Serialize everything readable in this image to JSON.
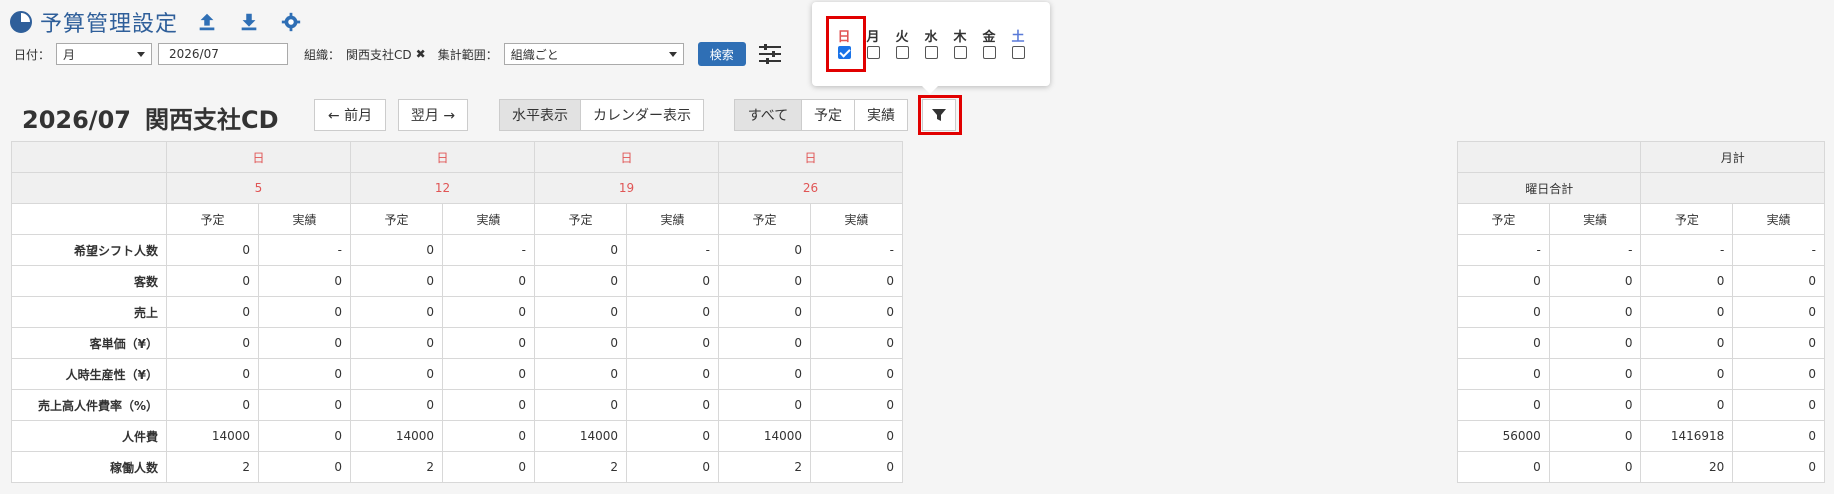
{
  "header": {
    "title": "予算管理設定",
    "icons": [
      "pie-chart-icon",
      "upload-icon",
      "download-icon",
      "gear-icon"
    ]
  },
  "filters": {
    "date_label": "日付：",
    "date_unit": "月",
    "date_value": "2026/07",
    "org_label": "組織：",
    "org_value": "関西支社CD",
    "scope_label": "集計範囲：",
    "scope_value": "組織ごと",
    "search_label": "検索"
  },
  "main": {
    "period": "2026/07",
    "org": "関西支社CD",
    "prev_label": "← 前月",
    "next_label": "翌月 →",
    "view_tabs": [
      "水平表示",
      "カレンダー表示"
    ],
    "kind_tabs": [
      "すべて",
      "予定",
      "実績"
    ]
  },
  "day_filter": {
    "days": [
      {
        "label": "日",
        "checked": true,
        "color": "#e05555"
      },
      {
        "label": "月",
        "checked": false,
        "color": "#333333"
      },
      {
        "label": "火",
        "checked": false,
        "color": "#333333"
      },
      {
        "label": "水",
        "checked": false,
        "color": "#333333"
      },
      {
        "label": "木",
        "checked": false,
        "color": "#333333"
      },
      {
        "label": "金",
        "checked": false,
        "color": "#333333"
      },
      {
        "label": "土",
        "checked": false,
        "color": "#5a7bd8"
      }
    ]
  },
  "table": {
    "weekday": "日",
    "dates": [
      "5",
      "12",
      "19",
      "26"
    ],
    "sub_headers": [
      "予定",
      "実績"
    ],
    "row_labels": [
      "希望シフト人数",
      "客数",
      "売上",
      "客単価（¥）",
      "人時生産性（¥）",
      "売上高人件費率（%）",
      "人件費",
      "稼働人数"
    ],
    "rows": [
      [
        "0",
        "-",
        "0",
        "-",
        "0",
        "-",
        "0",
        "-"
      ],
      [
        "0",
        "0",
        "0",
        "0",
        "0",
        "0",
        "0",
        "0"
      ],
      [
        "0",
        "0",
        "0",
        "0",
        "0",
        "0",
        "0",
        "0"
      ],
      [
        "0",
        "0",
        "0",
        "0",
        "0",
        "0",
        "0",
        "0"
      ],
      [
        "0",
        "0",
        "0",
        "0",
        "0",
        "0",
        "0",
        "0"
      ],
      [
        "0",
        "0",
        "0",
        "0",
        "0",
        "0",
        "0",
        "0"
      ],
      [
        "14000",
        "0",
        "14000",
        "0",
        "14000",
        "0",
        "14000",
        "0"
      ],
      [
        "2",
        "0",
        "2",
        "0",
        "2",
        "0",
        "2",
        "0"
      ]
    ]
  },
  "summary": {
    "weekday_total_label": "曜日合計",
    "monthly_label": "月計",
    "sub_headers": [
      "予定",
      "実績",
      "予定",
      "実績"
    ],
    "rows": [
      [
        "-",
        "-",
        "-",
        "-"
      ],
      [
        "0",
        "0",
        "0",
        "0"
      ],
      [
        "0",
        "0",
        "0",
        "0"
      ],
      [
        "0",
        "0",
        "0",
        "0"
      ],
      [
        "0",
        "0",
        "0",
        "0"
      ],
      [
        "0",
        "0",
        "0",
        "0"
      ],
      [
        "56000",
        "0",
        "1416918",
        "0"
      ],
      [
        "0",
        "0",
        "20",
        "0"
      ]
    ]
  },
  "colors": {
    "accent": "#2f6fb5",
    "highlight": "#e10000",
    "sunday": "#e05555",
    "saturday": "#5a7bd8"
  }
}
